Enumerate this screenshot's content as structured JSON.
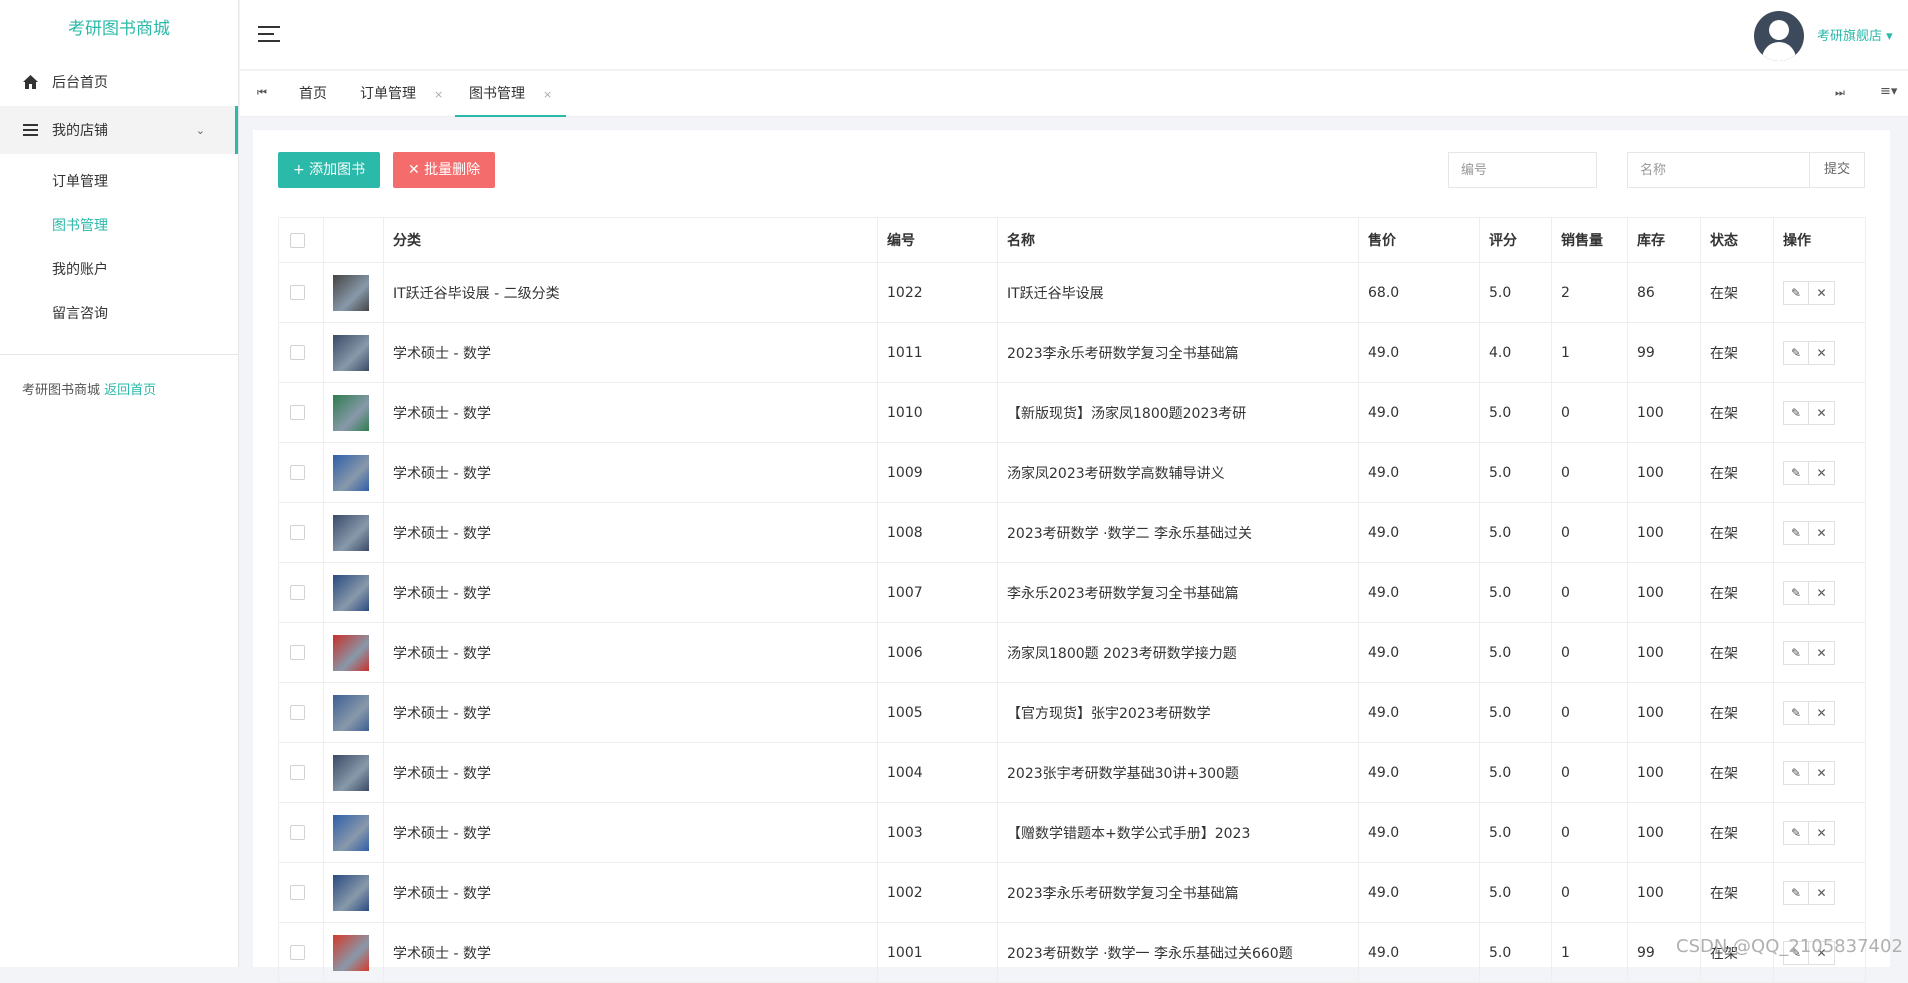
{
  "sidebar": {
    "brand": "考研图书商城",
    "home": "后台首页",
    "shop": "我的店铺",
    "sub_items": [
      "订单管理",
      "图书管理",
      "我的账户",
      "留言咨询"
    ],
    "footer_text": "考研图书商城",
    "footer_link": "返回首页"
  },
  "header": {
    "user_name": "考研旗舰店 ▾"
  },
  "tabs": {
    "home": "首页",
    "orders": "订单管理",
    "books": "图书管理",
    "close": "×"
  },
  "toolbar": {
    "add_label": "+  添加图书",
    "batch_delete_label": "✕  批量删除",
    "id_placeholder": "编号",
    "name_placeholder": "名称",
    "submit_label": "提交"
  },
  "table": {
    "headers": [
      "分类",
      "编号",
      "名称",
      "售价",
      "评分",
      "销售量",
      "库存",
      "状态",
      "操作"
    ],
    "rows": [
      {
        "category": "IT跃迁谷毕设展 - 二级分类",
        "id": "1022",
        "name": "IT跃迁谷毕设展",
        "price": "68.0",
        "rating": "5.0",
        "sales": "2",
        "stock": "86",
        "status": "在架",
        "thumb_color": "#444"
      },
      {
        "category": "学术硕士 - 数学",
        "id": "1011",
        "name": "2023李永乐考研数学复习全书基础篇",
        "price": "49.0",
        "rating": "4.0",
        "sales": "1",
        "stock": "99",
        "status": "在架",
        "thumb_color": "#3a4a66"
      },
      {
        "category": "学术硕士 - 数学",
        "id": "1010",
        "name": "【新版现货】汤家凤1800题2023考研",
        "price": "49.0",
        "rating": "5.0",
        "sales": "0",
        "stock": "100",
        "status": "在架",
        "thumb_color": "#2e7d4f"
      },
      {
        "category": "学术硕士 - 数学",
        "id": "1009",
        "name": "汤家凤2023考研数学高数辅导讲义",
        "price": "49.0",
        "rating": "5.0",
        "sales": "0",
        "stock": "100",
        "status": "在架",
        "thumb_color": "#2f5fa8"
      },
      {
        "category": "学术硕士 - 数学",
        "id": "1008",
        "name": "2023考研数学 ·数学二 李永乐基础过关",
        "price": "49.0",
        "rating": "5.0",
        "sales": "0",
        "stock": "100",
        "status": "在架",
        "thumb_color": "#394a6a"
      },
      {
        "category": "学术硕士 - 数学",
        "id": "1007",
        "name": "李永乐2023考研数学复习全书基础篇",
        "price": "49.0",
        "rating": "5.0",
        "sales": "0",
        "stock": "100",
        "status": "在架",
        "thumb_color": "#2a4a80"
      },
      {
        "category": "学术硕士 - 数学",
        "id": "1006",
        "name": "汤家凤1800题 2023考研数学接力题",
        "price": "49.0",
        "rating": "5.0",
        "sales": "0",
        "stock": "100",
        "status": "在架",
        "thumb_color": "#c8302a"
      },
      {
        "category": "学术硕士 - 数学",
        "id": "1005",
        "name": "【官方现货】张宇2023考研数学",
        "price": "49.0",
        "rating": "5.0",
        "sales": "0",
        "stock": "100",
        "status": "在架",
        "thumb_color": "#3d5f94"
      },
      {
        "category": "学术硕士 - 数学",
        "id": "1004",
        "name": "2023张宇考研数学基础30讲+300题",
        "price": "49.0",
        "rating": "5.0",
        "sales": "0",
        "stock": "100",
        "status": "在架",
        "thumb_color": "#3a4a66"
      },
      {
        "category": "学术硕士 - 数学",
        "id": "1003",
        "name": "【赠数学错题本+数学公式手册】2023",
        "price": "49.0",
        "rating": "5.0",
        "sales": "0",
        "stock": "100",
        "status": "在架",
        "thumb_color": "#2f5fa8"
      },
      {
        "category": "学术硕士 - 数学",
        "id": "1002",
        "name": "2023李永乐考研数学复习全书基础篇",
        "price": "49.0",
        "rating": "5.0",
        "sales": "0",
        "stock": "100",
        "status": "在架",
        "thumb_color": "#2a4a80"
      },
      {
        "category": "学术硕士 - 数学",
        "id": "1001",
        "name": "2023考研数学 ·数学一 李永乐基础过关660题",
        "price": "49.0",
        "rating": "5.0",
        "sales": "1",
        "stock": "99",
        "status": "在架",
        "thumb_color": "#d43a2a"
      }
    ],
    "edit_icon": "✎",
    "delete_icon": "✕"
  },
  "watermark": "CSDN @QQ_2105837402",
  "colors": {
    "accent": "#2bb9a9",
    "danger": "#f56c6c"
  }
}
